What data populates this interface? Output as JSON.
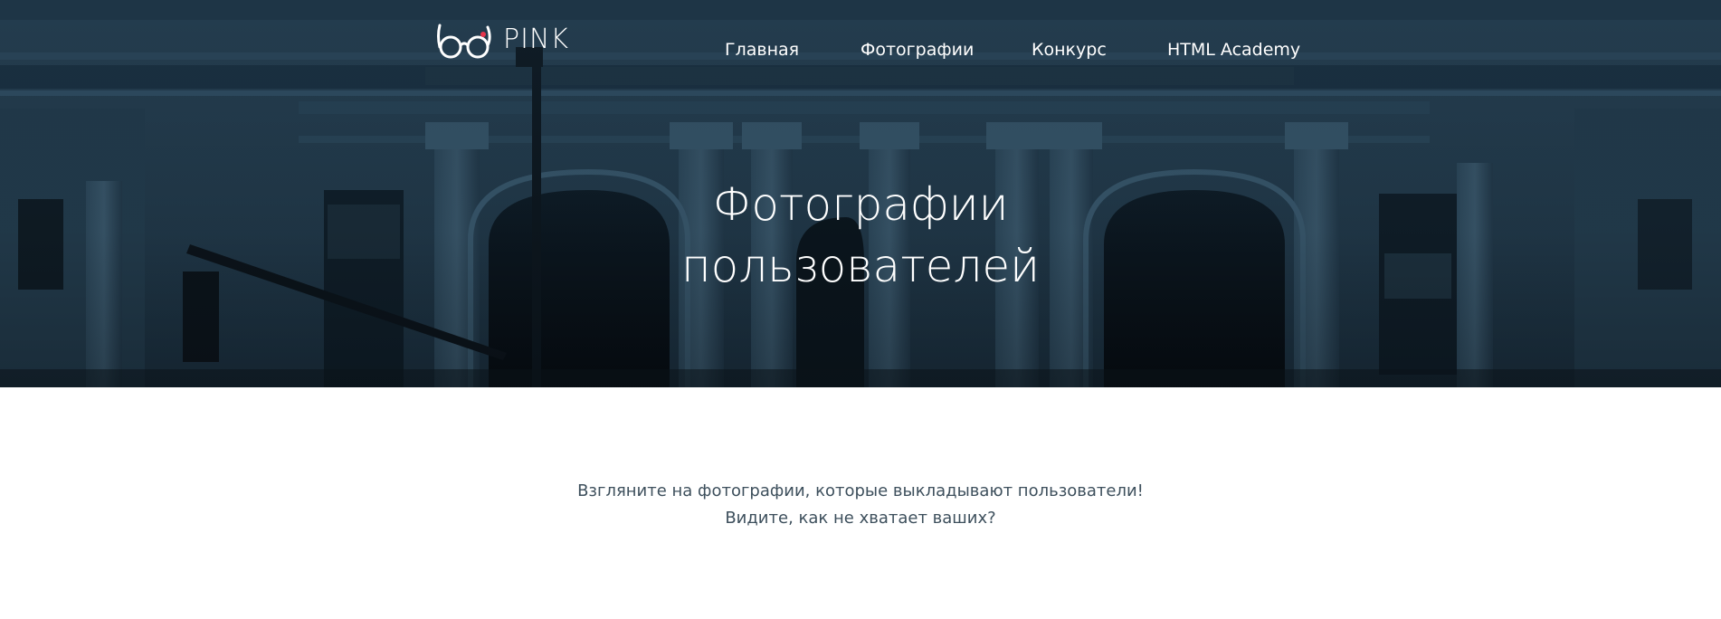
{
  "header": {
    "logo_text": "PINK",
    "nav": [
      {
        "label": "Главная"
      },
      {
        "label": "Фотографии"
      },
      {
        "label": "Конкурс"
      },
      {
        "label": "HTML Academy"
      }
    ]
  },
  "hero": {
    "title_line1": "Фотографии",
    "title_line2": "пользователей"
  },
  "intro": {
    "line1": "Взгляните на фотографии, которые выкладывают пользователи!",
    "line2": "Видите, как не хватает ваших?"
  },
  "colors": {
    "hero_tint": "#1b2f3d",
    "text_dark": "#3d4f5c",
    "logo_accent": "#e6354c",
    "white": "#ffffff"
  }
}
